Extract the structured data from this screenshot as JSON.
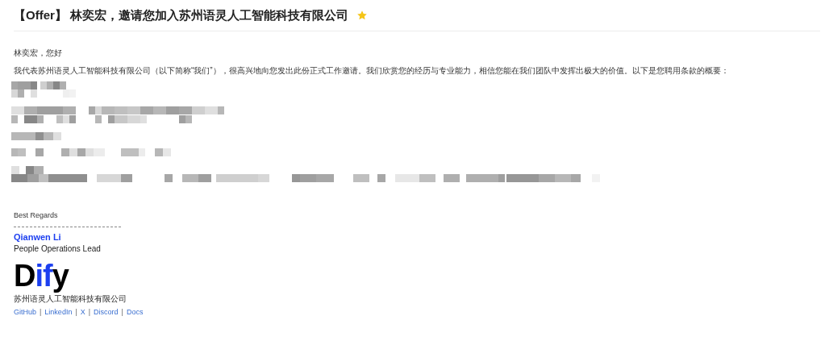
{
  "email": {
    "subject": "【Offer】 林奕宏，邀请您加入苏州语灵人工智能科技有限公司",
    "starred": true,
    "greeting": "林奕宏，您好",
    "intro": "我代表苏州语灵人工智能科技有限公司（以下简称“我们”），很高兴地向您发出此份正式工作邀请。我们欣赏您的经历与专业能力，相信您能在我们团队中发挥出极大的价值。以下是您聘用条款的概要：",
    "signature": {
      "closing": "Best Regards",
      "name": "Qianwen Li",
      "role": "People Operations Lead",
      "logo_parts": [
        {
          "text": "D",
          "color": "#000000"
        },
        {
          "text": "if",
          "color": "#1c3ff0"
        },
        {
          "text": "y",
          "color": "#000000"
        }
      ],
      "company": "苏州语灵人工智能科技有限公司",
      "links": [
        {
          "kind": "link",
          "text": "GitHub"
        },
        {
          "kind": "separator",
          "text": "|"
        },
        {
          "kind": "link",
          "text": "LinkedIn"
        },
        {
          "kind": "separator",
          "text": "|"
        },
        {
          "kind": "link",
          "text": "X"
        },
        {
          "kind": "separator",
          "text": "|"
        },
        {
          "kind": "link",
          "text": "Discord"
        },
        {
          "kind": "separator",
          "text": "|"
        },
        {
          "kind": "link",
          "text": "Docs"
        }
      ]
    }
  }
}
